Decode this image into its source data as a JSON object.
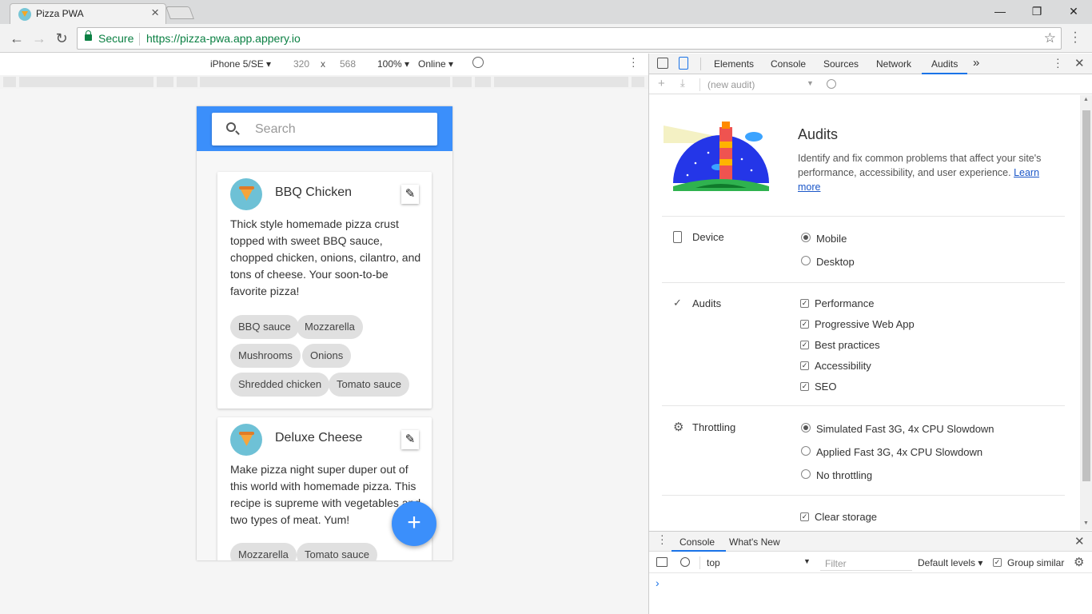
{
  "browser": {
    "tab_title": "Pizza PWA",
    "tab_close": "×",
    "window_controls": {
      "minimize": "—",
      "restore": "❐",
      "close": "✕"
    },
    "secure_label": "Secure",
    "url": "https://pizza-pwa.app.appery.io",
    "star": "☆",
    "back": "←",
    "forward": "→",
    "reload": "↻"
  },
  "emulation": {
    "device": "iPhone 5/SE ▾",
    "width": "320",
    "times": "x",
    "height": "568",
    "zoom": "100% ▾",
    "network": "Online ▾"
  },
  "app": {
    "search_placeholder": "Search",
    "fab_label": "+",
    "cards": [
      {
        "title": "BBQ Chicken",
        "description": "Thick style homemade pizza crust topped with sweet BBQ sauce, chopped chicken, onions, cilantro, and tons of cheese. Your soon-to-be favorite pizza!",
        "tags": [
          "BBQ sauce",
          "Mozzarella",
          "Mushrooms",
          "Onions",
          "Shredded chicken",
          "Tomato sauce"
        ]
      },
      {
        "title": "Deluxe Cheese",
        "description": "Make pizza night super duper out of this world with homemade pizza. This recipe is supreme with vegetables and two types of meat. Yum!",
        "tags": [
          "Mozzarella",
          "Tomato sauce"
        ]
      }
    ]
  },
  "devtools": {
    "tabs": [
      "Elements",
      "Console",
      "Sources",
      "Network",
      "Audits"
    ],
    "more_tabs": "»",
    "audit_select": "(new audit)",
    "audits": {
      "title": "Audits",
      "description": "Identify and fix common problems that affect your site's performance, accessibility, and user experience.",
      "learn_more": "Learn more",
      "device_label": "Device",
      "device_options": [
        "Mobile",
        "Desktop"
      ],
      "device_selected": "Mobile",
      "audits_label": "Audits",
      "audit_categories": [
        "Performance",
        "Progressive Web App",
        "Best practices",
        "Accessibility",
        "SEO"
      ],
      "throttling_label": "Throttling",
      "throttling_options": [
        "Simulated Fast 3G, 4x CPU Slowdown",
        "Applied Fast 3G, 4x CPU Slowdown",
        "No throttling"
      ],
      "throttling_selected": "Simulated Fast 3G, 4x CPU Slowdown",
      "clear_storage": "Clear storage"
    },
    "drawer": {
      "tabs": [
        "Console",
        "What's New"
      ],
      "context": "top",
      "filter_placeholder": "Filter",
      "levels": "Default levels ▾",
      "group_similar": "Group similar",
      "prompt": "›"
    }
  },
  "colors": {
    "brand_blue": "#3b8ffb",
    "secure_green": "#0b8043",
    "devtools_accent": "#1a73e8"
  }
}
